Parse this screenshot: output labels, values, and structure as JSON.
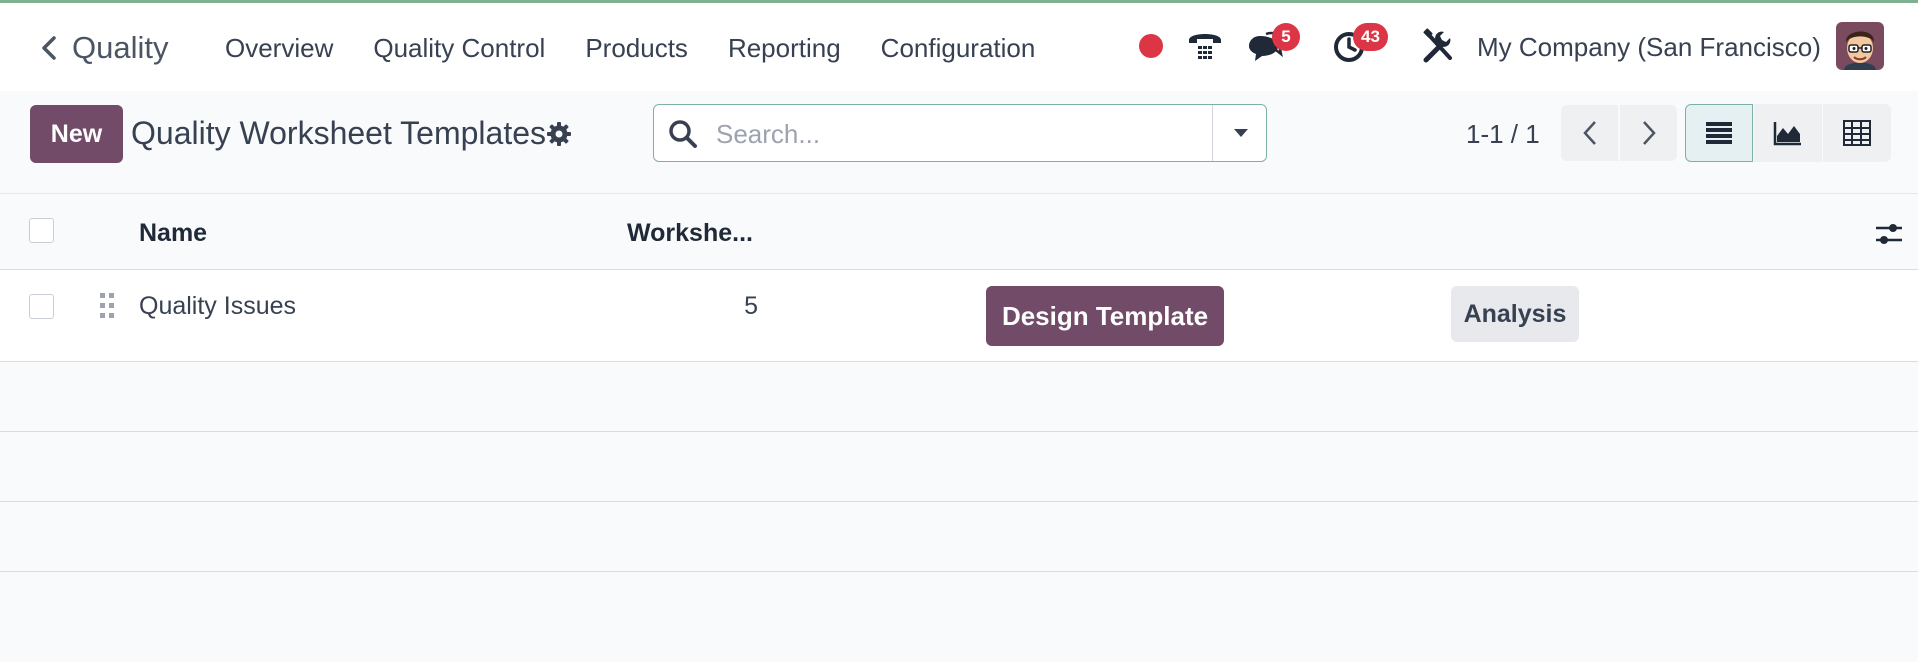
{
  "navbar": {
    "app_name": "Quality",
    "menu": [
      "Overview",
      "Quality Control",
      "Products",
      "Reporting",
      "Configuration"
    ],
    "chat_badge": "5",
    "activity_badge": "43",
    "company": "My Company (San Francisco)"
  },
  "control_panel": {
    "new_label": "New",
    "title": "Quality Worksheet Templates",
    "search_placeholder": "Search...",
    "pager": "1-1 / 1"
  },
  "list": {
    "columns": [
      "Name",
      "Workshe..."
    ],
    "rows": [
      {
        "name": "Quality Issues",
        "count": "5",
        "design_label": "Design Template",
        "analysis_label": "Analysis"
      }
    ]
  },
  "colors": {
    "primary": "#714b67",
    "badge": "#dc3545",
    "record_dot": "#dc3545",
    "focus_border": "#7fb0a8"
  }
}
